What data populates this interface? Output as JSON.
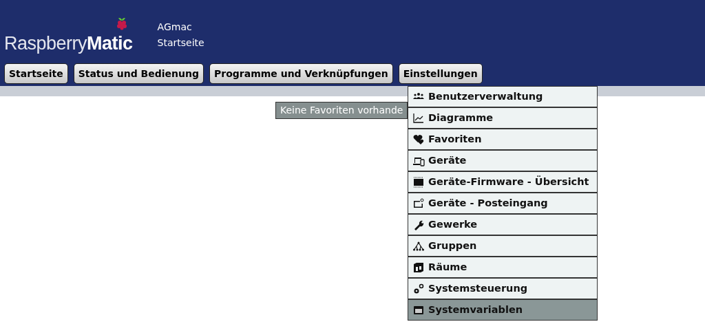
{
  "header": {
    "logo": "Raspberry**Matic**",
    "user": "AGmac",
    "page": "Startseite"
  },
  "nav": [
    {
      "label": "Startseite"
    },
    {
      "label": "Status und Bedienung"
    },
    {
      "label": "Programme und Verknüpfungen"
    },
    {
      "label": "Einstellungen"
    }
  ],
  "message": "Keine Favoriten vorhande",
  "menu": [
    {
      "label": "Benutzerverwaltung",
      "selected": false
    },
    {
      "label": "Diagramme",
      "selected": false
    },
    {
      "label": "Favoriten",
      "selected": false
    },
    {
      "label": "Geräte",
      "selected": false
    },
    {
      "label": "Geräte-Firmware - Übersicht",
      "selected": false
    },
    {
      "label": "Geräte - Posteingang",
      "selected": false
    },
    {
      "label": "Gewerke",
      "selected": false
    },
    {
      "label": "Gruppen",
      "selected": false
    },
    {
      "label": "Räume",
      "selected": false
    },
    {
      "label": "Systemsteuerung",
      "selected": false
    },
    {
      "label": "Systemvariablen",
      "selected": true
    }
  ]
}
